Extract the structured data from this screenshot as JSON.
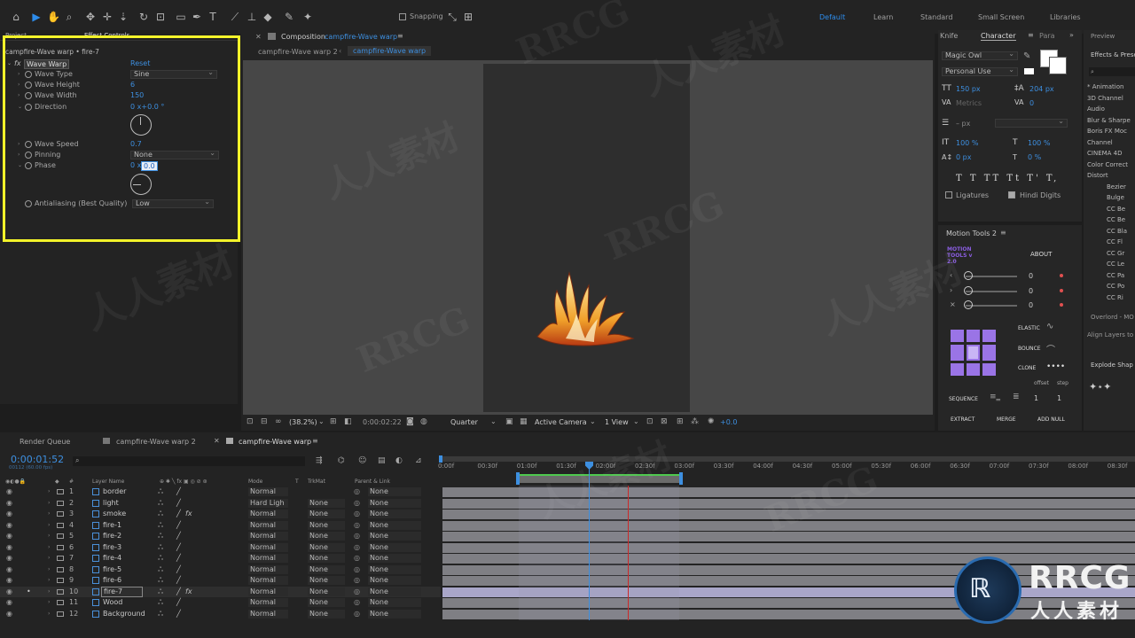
{
  "toolbar": {
    "snapping": "Snapping",
    "workspaces": [
      "Default",
      "Learn",
      "Standard",
      "Small Screen",
      "Libraries"
    ]
  },
  "effects": {
    "tabs": [
      "Project",
      "Effect Controls"
    ],
    "layer_title": "campfire-Wave warp • fire-7",
    "fx_name": "Wave Warp",
    "reset": "Reset",
    "props": {
      "wave_type": "Wave Type",
      "wave_type_value": "Sine",
      "wave_height": "Wave Height",
      "wave_height_value": "6",
      "wave_width": "Wave Width",
      "wave_width_value": "150",
      "direction": "Direction",
      "direction_value": "0 x+0.0 °",
      "wave_speed": "Wave Speed",
      "wave_speed_value": "0.7",
      "pinning": "Pinning",
      "pinning_value": "None",
      "phase": "Phase",
      "phase_value": "0 x",
      "phase_edit": "0.0",
      "antialiasing": "Antialiasing (Best Quality)",
      "antialiasing_value": "Low"
    }
  },
  "composition": {
    "tab": "Composition",
    "tab_name": "campfire-Wave warp",
    "crumbs": [
      "campfire-Wave warp 2",
      "campfire-Wave warp"
    ],
    "footer": {
      "zoom": "(38.2%)",
      "time": "0:00:02:22",
      "res": "Quarter",
      "camera": "Active Camera",
      "views": "1 View",
      "exposure": "+0.0"
    }
  },
  "character": {
    "tabs": [
      "Knife",
      "Character",
      "Para"
    ],
    "font": "Magic Owl",
    "style": "Personal Use",
    "size": "150 px",
    "leading": "204 px",
    "kerning": "Metrics",
    "tracking": "0",
    "stroke": "– px",
    "vscale": "100 %",
    "hscale": "100 %",
    "baseline": "0 px",
    "tsume": "0 %",
    "styles": "T T TT Tt T' T,",
    "ligatures": "Ligatures",
    "hindi": "Hindi Digits"
  },
  "motion": {
    "title": "Motion Tools 2",
    "logo": "MOTION TOOLS v 2.0",
    "about": "ABOUT",
    "v1": "0",
    "v2": "0",
    "v3": "0",
    "elastic": "ELASTIC",
    "bounce": "BOUNCE",
    "clone": "CLONE",
    "offset": "offset",
    "step": "step",
    "sequence": "SEQUENCE",
    "seq1": "1",
    "seq2": "1",
    "extract": "EXTRACT",
    "merge": "MERGE",
    "addnull": "ADD NULL"
  },
  "right": {
    "preview": "Preview",
    "effects": "Effects & Presets",
    "items": [
      "* Animation",
      "3D Channel",
      "Audio",
      "Blur & Sharpe",
      "Boris FX Moc",
      "Channel",
      "CINEMA 4D",
      "Color Correct",
      "Distort",
      "Bezier",
      "Bulge",
      "CC Be",
      "CC Be",
      "CC Bla",
      "CC Fl",
      "CC Gr",
      "CC Le",
      "CC Pa",
      "CC Po",
      "CC Ri"
    ],
    "overlord": "Overlord - MO",
    "align": "Align Layers to",
    "explode": "Explode Shap"
  },
  "timeline": {
    "tabs": [
      "Render Queue",
      "campfire-Wave warp 2",
      "campfire-Wave warp"
    ],
    "timecode": "0:00:01:52",
    "frames": "00112 (60.00 fps)",
    "headers": {
      "layer_name": "Layer Name",
      "mode": "Mode",
      "t": "T",
      "trkmat": "TrkMat",
      "parent": "Parent & Link"
    },
    "ticks": [
      "0:00f",
      "00:30f",
      "01:00f",
      "01:30f",
      "02:00f",
      "02:30f",
      "03:00f",
      "03:30f",
      "04:00f",
      "04:30f",
      "05:00f",
      "05:30f",
      "06:00f",
      "06:30f",
      "07:00f",
      "07:30f",
      "08:00f",
      "08:30f"
    ],
    "layers": [
      {
        "num": "1",
        "name": "border",
        "mode": "Normal",
        "trk": "",
        "parent": "None"
      },
      {
        "num": "2",
        "name": "light",
        "mode": "Hard Ligh",
        "trk": "None",
        "parent": "None"
      },
      {
        "num": "3",
        "name": "smoke",
        "mode": "Normal",
        "trk": "None",
        "parent": "None"
      },
      {
        "num": "4",
        "name": "fire-1",
        "mode": "Normal",
        "trk": "None",
        "parent": "None"
      },
      {
        "num": "5",
        "name": "fire-2",
        "mode": "Normal",
        "trk": "None",
        "parent": "None"
      },
      {
        "num": "6",
        "name": "fire-3",
        "mode": "Normal",
        "trk": "None",
        "parent": "None"
      },
      {
        "num": "7",
        "name": "fire-4",
        "mode": "Normal",
        "trk": "None",
        "parent": "None"
      },
      {
        "num": "8",
        "name": "fire-5",
        "mode": "Normal",
        "trk": "None",
        "parent": "None"
      },
      {
        "num": "9",
        "name": "fire-6",
        "mode": "Normal",
        "trk": "None",
        "parent": "None"
      },
      {
        "num": "10",
        "name": "fire-7",
        "mode": "Normal",
        "trk": "None",
        "parent": "None"
      },
      {
        "num": "11",
        "name": "Wood",
        "mode": "Normal",
        "trk": "None",
        "parent": "None"
      },
      {
        "num": "12",
        "name": "Background",
        "mode": "Normal",
        "trk": "None",
        "parent": "None"
      }
    ]
  },
  "watermark": {
    "brand": "RRCG",
    "cn": "人人素材",
    "logo_text": "RRCG",
    "logo_cn": "人人素材"
  }
}
